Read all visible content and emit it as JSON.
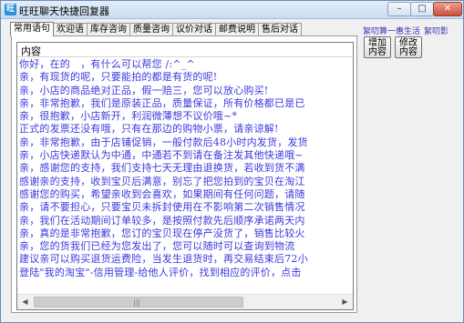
{
  "window": {
    "title": "旺旺聊天快捷回复器",
    "app_icon": "wangwang-icon",
    "controls": {
      "minimize": "–",
      "maximize": "□",
      "close": "✕"
    }
  },
  "tabs": [
    {
      "label": "常用语句",
      "active": true
    },
    {
      "label": "欢迎语",
      "active": false
    },
    {
      "label": "库存咨询",
      "active": false
    },
    {
      "label": "质量咨询",
      "active": false
    },
    {
      "label": "议价对话",
      "active": false
    },
    {
      "label": "邮费说明",
      "active": false
    },
    {
      "label": "售后对话",
      "active": false
    }
  ],
  "list": {
    "column_header": "内容",
    "rows": [
      "你好，在的　，有什么可以帮您 /:^_^",
      "亲，有现货的呢，只要能拍的都是有货的呢!",
      "亲，小店的商品绝对正品，假一赔三，您可以放心购买!",
      "亲，非常抱歉，我们是原装正品，质量保证，所有价格都已是已",
      "亲，很抱歉，小店新开，利润微薄想不议价哦~*",
      "正式的发票还没有哦，只有在那边的购物小票，请亲谅解!",
      "亲，非常抱歉，由于店铺促销，一般付款后48小时内发货，发货",
      "亲，小店快递默认为中通，中通若不到请在备注发其他快递哦~",
      "亲，感谢您的支持，我们支持七天无理由退换货，若收到货不满",
      "感谢亲的支持，收到宝贝后满意，别忘了把您拍到的宝贝在淘江",
      "感谢您的购买，希望亲收到会喜欢，如果期间有任何问题，请随",
      "亲，请不要担心，只要宝贝未拆封使用在不影响第二次销售情况",
      "亲，我们在活动期间订单较多，是按照付款先后顺序承诺两天内",
      "亲，真的是非常抱歉，您订的宝贝现在停产没货了，销售比较火",
      "亲，您的货我们已经为您发出了，您可以随时可以查询到物流",
      "建议亲可以购买退货运费险，当发生退货时，再交易结束后72小",
      "登陆\"我的淘宝\"-信用管理-给他人评价，找到相应的评价，点击"
    ]
  },
  "scrollbar": {
    "left_arrow": "◀",
    "right_arrow": "▶",
    "grip": "|||"
  },
  "promo": {
    "part1": "絮叨算一惠生活",
    "part2": "絮叨影"
  },
  "buttons": {
    "add": "增加内容",
    "edit": "修改内容"
  }
}
